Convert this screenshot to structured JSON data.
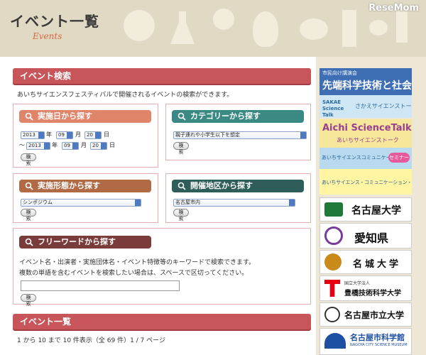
{
  "header": {
    "title": "イベント一覧",
    "subtitle": "Events",
    "brand": "ReseMom"
  },
  "search": {
    "title": "イベント検索",
    "description": "あいちサイエンスフェスティバルで開催されるイベントの検索ができます。",
    "date": {
      "title": "実施日から探す",
      "from": {
        "year": "2013",
        "month": "09",
        "day": "20"
      },
      "to": {
        "year": "2013",
        "month": "09",
        "day": "20"
      },
      "unit_year": "年",
      "unit_month": "月",
      "unit_day": "日",
      "tilde": "〜",
      "button": "検索"
    },
    "category": {
      "title": "カテゴリーから探す",
      "value": "親子連れや小学生以下を想定",
      "button": "検索"
    },
    "format": {
      "title": "実施形態から探す",
      "value": "シンポジウム",
      "button": "検索"
    },
    "area": {
      "title": "開催地区から探す",
      "value": "名古屋市内",
      "button": "検索"
    },
    "freeword": {
      "title": "フリーワードから探す",
      "help1": "イベント名・出演者・実施団体名・イベント特徴等のキーワードで検索できます。",
      "help2": "複数の単語を含むイベントを検索したい場合は、スペースで区切ってください。",
      "input_value": "",
      "button": "検索"
    }
  },
  "list": {
    "title": "イベント一覧",
    "summary": "1 から 10 まで 10 件表示（全 69 件）1 / 7 ページ"
  },
  "sidebar": {
    "banner1": {
      "top": "市民向け講演会",
      "main": "先端科学技術と社会"
    },
    "banner2": {
      "left": "SAKAE Science Talk",
      "right": "さかえサイエンストーク"
    },
    "banner3": {
      "main": "Aichi ScienceTalk",
      "sub": "あいちサイエンストーク"
    },
    "banner4": {
      "main": "あいちサイエンスコミュニケーション",
      "badge": "セミナー"
    },
    "banner5": {
      "main": "あいちサイエンス・コミュニケーション・ネットワーク"
    },
    "uni1": "名古屋大学",
    "uni2": "愛知県",
    "uni3": "名城大学",
    "uni4": {
      "small": "国立大学法人",
      "main": "豊橋技術科学大学"
    },
    "uni5": "名古屋市立大学",
    "uni6": {
      "main": "名古屋市科学館",
      "sub": "NAGOYA CITY SCIENCE MUSEUM"
    }
  },
  "colors": {
    "accent": "#c8555a",
    "date": "#e0856a",
    "category": "#3a8a83",
    "format": "#b06a45",
    "area": "#2f5e5a",
    "freeword": "#7a3b3b"
  }
}
